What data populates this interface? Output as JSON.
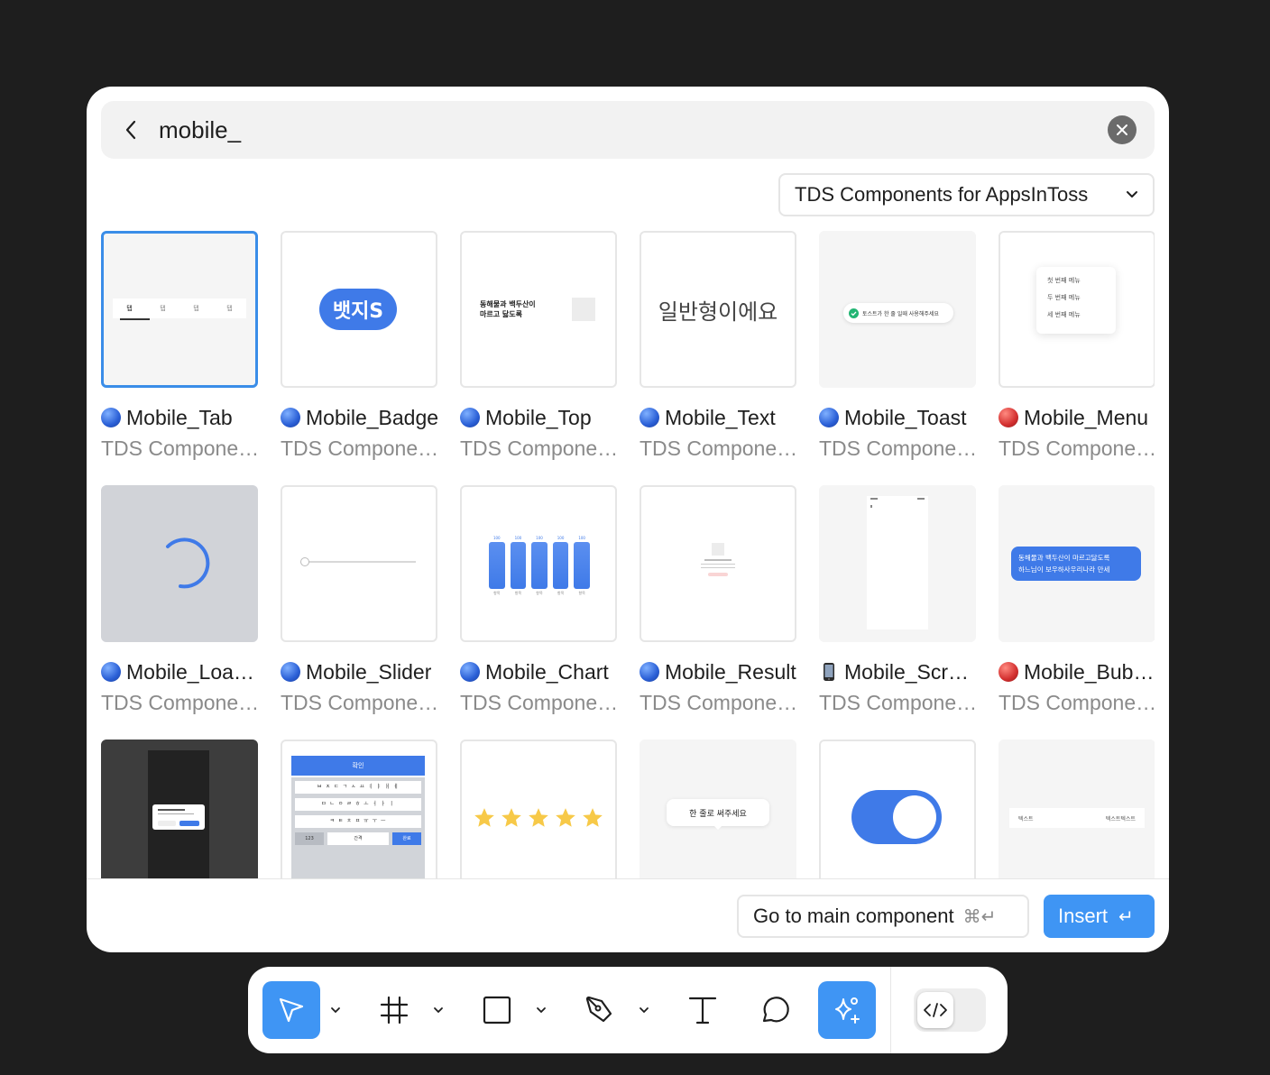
{
  "search": {
    "value": "mobile_",
    "placeholder": ""
  },
  "library_select": {
    "label": "TDS Components for AppsInToss"
  },
  "components": [
    {
      "title": "Mobile_Tab",
      "subtitle": "TDS Components for AppsInToss",
      "status": "blue"
    },
    {
      "title": "Mobile_Badge",
      "subtitle": "TDS Components for AppsInToss",
      "status": "blue"
    },
    {
      "title": "Mobile_Top",
      "subtitle": "TDS Components for AppsInToss",
      "status": "blue"
    },
    {
      "title": "Mobile_Text",
      "subtitle": "TDS Components for AppsInToss",
      "status": "blue"
    },
    {
      "title": "Mobile_Toast",
      "subtitle": "TDS Components for AppsInToss",
      "status": "blue"
    },
    {
      "title": "Mobile_Menu",
      "subtitle": "TDS Components for AppsInToss",
      "status": "red"
    },
    {
      "title": "Mobile_Loader",
      "subtitle": "TDS Components for AppsInToss",
      "status": "blue"
    },
    {
      "title": "Mobile_Slider",
      "subtitle": "TDS Components for AppsInToss",
      "status": "blue"
    },
    {
      "title": "Mobile_Chart",
      "subtitle": "TDS Components for AppsInToss",
      "status": "blue"
    },
    {
      "title": "Mobile_Result",
      "subtitle": "TDS Components for AppsInToss",
      "status": "blue"
    },
    {
      "title": "Mobile_Screen",
      "subtitle": "TDS Components for AppsInToss",
      "status": "phone"
    },
    {
      "title": "Mobile_Bubble",
      "subtitle": "TDS Components for AppsInToss",
      "status": "red"
    }
  ],
  "previews": {
    "tab_labels": [
      "탭",
      "탭",
      "탭",
      "탭"
    ],
    "badge_text": "뱃지S",
    "top_text": "동해물과 백두산이\n마르고 닳도록",
    "text_preview": "일반형이에요",
    "toast_text": "토스트가 한 줄 일때 사용해주세요",
    "menu_items": [
      "첫 번째 메뉴",
      "두 번째 메뉴",
      "세 번째 메뉴"
    ],
    "chart_value_label": "100",
    "chart_axis_label": "항목",
    "bubble_text": "동해물과 백두산이 마르고닳도록\n하느님이 보우하사우리나라 만세",
    "keyboard_confirm": "확인",
    "keyboard_rows": [
      "ㅂ ㅈ ㄷ ㄱ ㅅ ㅛ ㅕ ㅑ ㅐ ㅔ",
      "ㅁ ㄴ ㅇ ㄹ ㅎ ㅗ ㅓ ㅏ ㅣ",
      "ㅋ ㅌ ㅊ ㅍ ㅠ ㅜ ㅡ"
    ],
    "keyboard_123": "123",
    "keyboard_space": "간격",
    "keyboard_done": "완료",
    "tooltip_text": "한 줄로 써주세요",
    "list_left": "텍스트",
    "list_right": "텍스트텍스트"
  },
  "footer": {
    "goto_label": "Go to main component",
    "goto_shortcut": "⌘↵",
    "insert_label": "Insert",
    "insert_shortcut": "↵"
  },
  "toolbar": {
    "tools": [
      "move-tool",
      "frame-tool",
      "shape-tool",
      "pen-tool",
      "text-tool",
      "comment-tool",
      "actions-tool"
    ],
    "active_tools": [
      "move-tool",
      "actions-tool"
    ],
    "accent": "#3f95f4"
  },
  "colors": {
    "accent": "#3f95f4",
    "selected_border": "#3a8de8",
    "chart_blue": "#3f7ae8"
  }
}
